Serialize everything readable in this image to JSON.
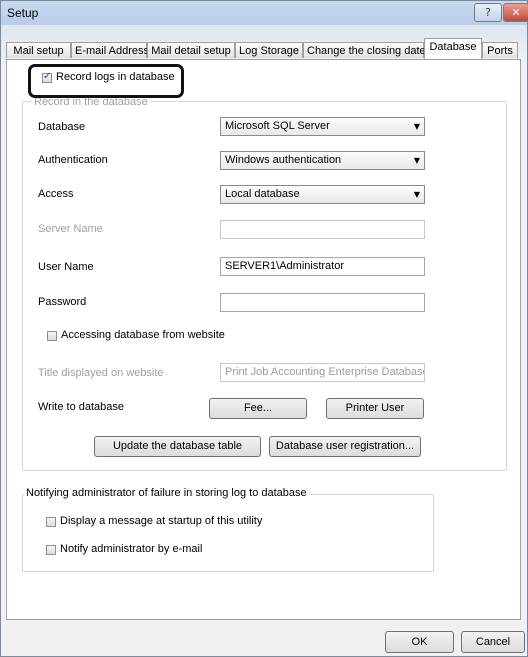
{
  "window": {
    "title": "Setup",
    "help_label": "?",
    "close_label": "✕"
  },
  "tabs": [
    "Mail setup",
    "E-mail Address",
    "Mail detail setup",
    "Log Storage",
    "Change the closing date",
    "Database",
    "Ports"
  ],
  "record_logs": {
    "label": "Record logs in database",
    "checked": true
  },
  "record_group": {
    "title": "Record in the database",
    "database": {
      "label": "Database",
      "value": "Microsoft SQL Server"
    },
    "authentication": {
      "label": "Authentication",
      "value": "Windows authentication"
    },
    "access": {
      "label": "Access",
      "value": "Local database"
    },
    "server_name": {
      "label": "Server Name",
      "value": ""
    },
    "user_name": {
      "label": "User Name",
      "value": "SERVER1\\Administrator"
    },
    "password": {
      "label": "Password",
      "value": ""
    },
    "web_access": {
      "label": "Accessing database from website",
      "checked": false
    },
    "web_title": {
      "label": "Title displayed on website",
      "value": "Print Job Accounting Enterprise Database"
    },
    "write": {
      "label": "Write to database",
      "fee_label": "Fee...",
      "printer_user_label": "Printer User"
    },
    "update_table_label": "Update the database table",
    "user_registration_label": "Database user registration..."
  },
  "notify_group": {
    "title": "Notifying administrator of failure in storing log to database",
    "display_message": {
      "label": "Display a message at startup of this utility",
      "checked": false
    },
    "notify_email": {
      "label": "Notify administrator by e-mail",
      "checked": false
    }
  },
  "footer": {
    "ok_label": "OK",
    "cancel_label": "Cancel"
  },
  "colors": {
    "title_bar": "#b8cde8",
    "close_button": "#c4463a",
    "highlight_border": "#111111"
  }
}
